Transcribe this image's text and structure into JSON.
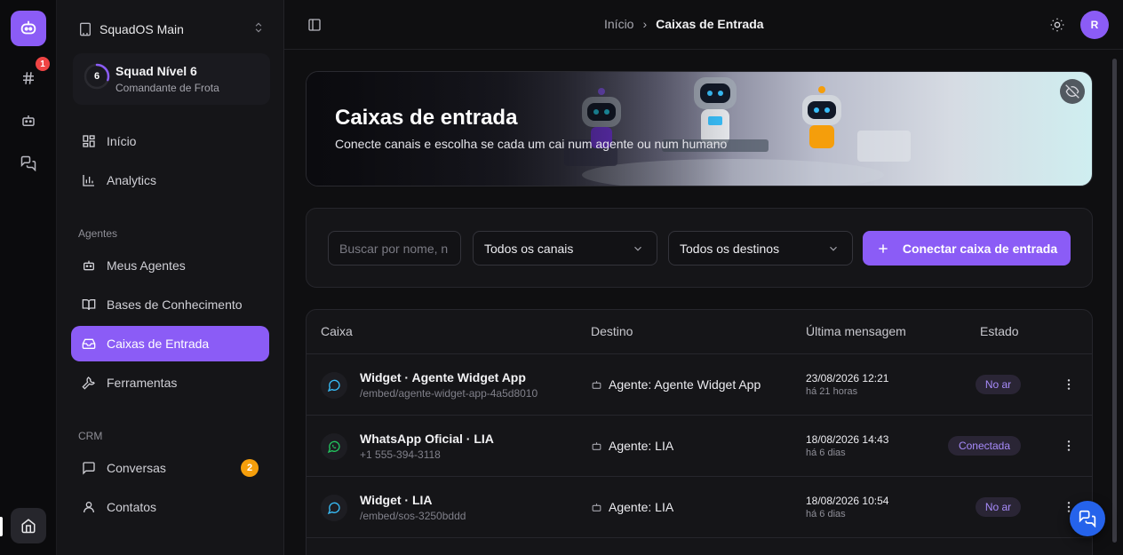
{
  "rail": {
    "notification_count": "1"
  },
  "sidebar": {
    "workspace": "SquadOS Main",
    "squad": {
      "level": "6",
      "title": "Squad Nível 6",
      "subtitle": "Comandante de Frota",
      "progress": 0.3
    },
    "items_top": [
      {
        "label": "Início",
        "icon": "layout-grid-icon"
      },
      {
        "label": "Analytics",
        "icon": "bar-chart-icon"
      }
    ],
    "section_agents": "Agentes",
    "items_agents": [
      {
        "label": "Meus Agentes",
        "icon": "bot-icon"
      },
      {
        "label": "Bases de Conhecimento",
        "icon": "book-icon"
      },
      {
        "label": "Caixas de Entrada",
        "icon": "inbox-icon",
        "active": true
      },
      {
        "label": "Ferramentas",
        "icon": "wrench-icon"
      }
    ],
    "section_crm": "CRM",
    "items_crm": [
      {
        "label": "Conversas",
        "icon": "message-icon",
        "badge": "2"
      },
      {
        "label": "Contatos",
        "icon": "user-icon"
      }
    ]
  },
  "header": {
    "breadcrumb_home": "Início",
    "breadcrumb_sep": "›",
    "breadcrumb_current": "Caixas de Entrada",
    "avatar_initial": "R"
  },
  "hero": {
    "title": "Caixas de entrada",
    "subtitle": "Conecte canais e escolha se cada um cai num agente ou num humano"
  },
  "filters": {
    "search_placeholder": "Buscar por nome, n",
    "channel_select": "Todos os canais",
    "destination_select": "Todos os destinos",
    "connect_button": "Conectar caixa de entrada"
  },
  "table": {
    "headers": {
      "caixa": "Caixa",
      "destino": "Destino",
      "ultima": "Última mensagem",
      "estado": "Estado"
    },
    "rows": [
      {
        "type": "widget",
        "name": "Widget · Agente Widget App",
        "path": "/embed/agente-widget-app-4a5d8010",
        "dest": "Agente: Agente Widget App",
        "date": "23/08/2026 12:21",
        "rel": "há 21 horas",
        "status": "No ar"
      },
      {
        "type": "whatsapp",
        "name": "WhatsApp Oficial · LIA",
        "path": "+1 555-394-3118",
        "dest": "Agente: LIA",
        "date": "18/08/2026 14:43",
        "rel": "há 6 dias",
        "status": "Conectada"
      },
      {
        "type": "widget",
        "name": "Widget · LIA",
        "path": "/embed/sos-3250bddd",
        "dest": "Agente: LIA",
        "date": "18/08/2026 10:54",
        "rel": "há 6 dias",
        "status": "No ar"
      }
    ]
  },
  "colors": {
    "accent": "#8b5cf6",
    "badge_red": "#ef4444",
    "badge_amber": "#f59e0b",
    "whatsapp": "#22c55e",
    "widget": "#38bdf8",
    "fab": "#2563eb"
  }
}
